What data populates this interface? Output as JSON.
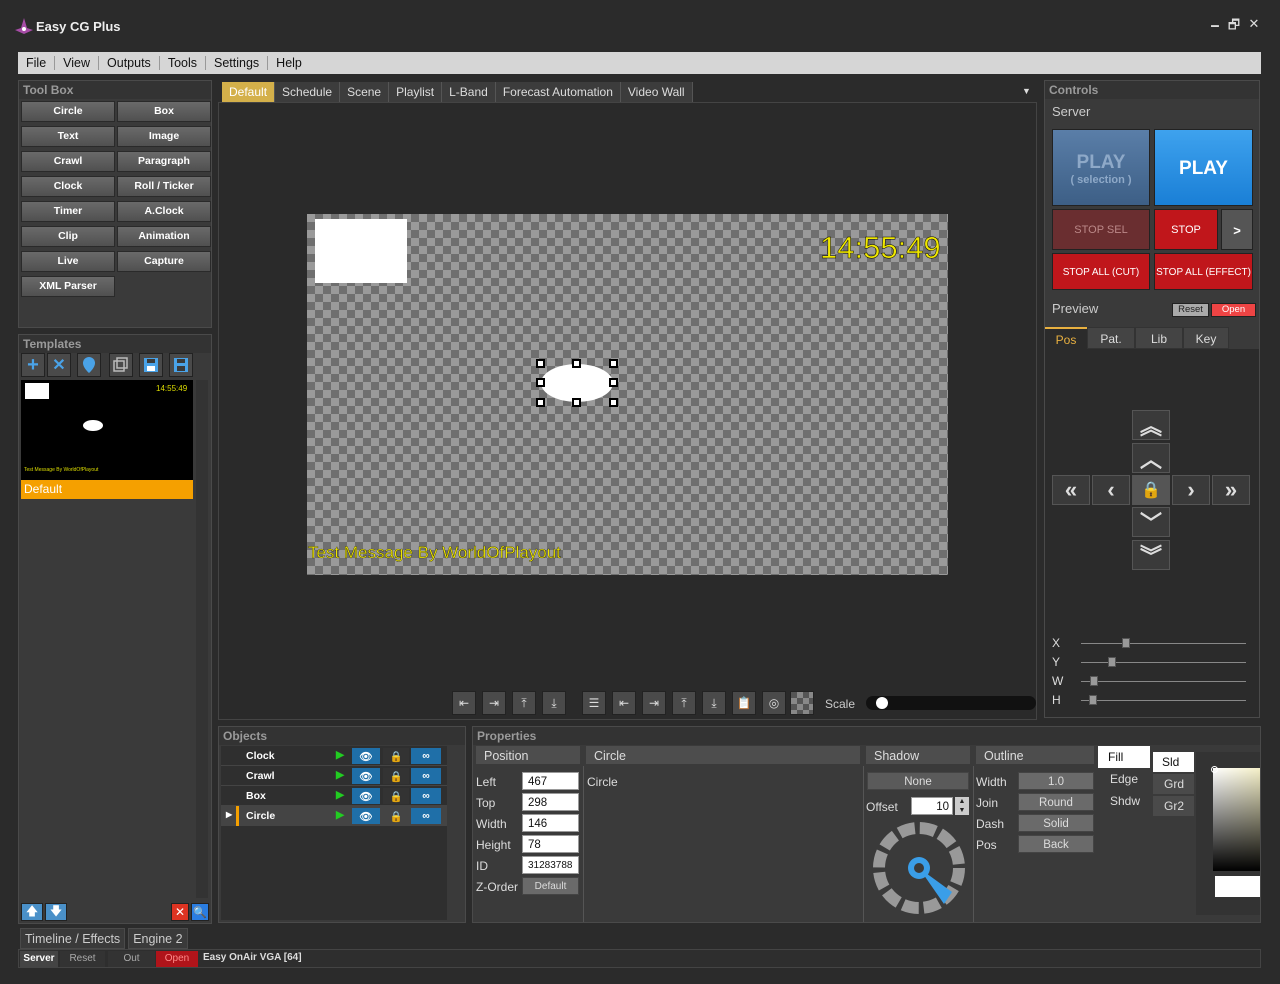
{
  "app": {
    "title": "Easy CG Plus",
    "win_min": "🗕",
    "win_max": "🗗",
    "win_close": "✕"
  },
  "menu": [
    "File",
    "View",
    "Outputs",
    "Tools",
    "Settings",
    "Help"
  ],
  "toolbox": {
    "title": "Tool Box",
    "buttons": [
      "Circle",
      "Box",
      "Text",
      "Image",
      "Crawl",
      "Paragraph",
      "Clock",
      "Roll / Ticker",
      "Timer",
      "A.Clock",
      "Clip",
      "Animation",
      "Live",
      "Capture",
      "XML Parser"
    ]
  },
  "templates": {
    "title": "Templates",
    "thumb_time": "14:55:49",
    "thumb_msg": "Test Message By WorldOfPlayout",
    "selected": "Default"
  },
  "tabs": [
    "Default",
    "Schedule",
    "Scene",
    "Playlist",
    "L-Band",
    "Forecast Automation",
    "Video Wall"
  ],
  "canvas": {
    "clock": "14:55:49",
    "message": "Test Message By WorldOfPlayout"
  },
  "toolbar": {
    "scale_label": "Scale"
  },
  "controls": {
    "title": "Controls",
    "server_label": "Server",
    "play_sel": "PLAY",
    "play_sel_sub": "( selection )",
    "play": "PLAY",
    "stop_sel": "STOP SEL",
    "stop": "STOP",
    "more": ">",
    "stop_all_cut": "STOP ALL (CUT)",
    "stop_all_effect": "STOP ALL (EFFECT)",
    "preview_label": "Preview",
    "reset": "Reset",
    "open": "Open",
    "subtabs": [
      "Pos",
      "Pat.",
      "Lib",
      "Key"
    ],
    "sliders": [
      "X",
      "Y",
      "W",
      "H"
    ],
    "slider_values": [
      0.27,
      0.19,
      0.08,
      0.07
    ]
  },
  "objects": {
    "title": "Objects",
    "rows": [
      "Clock",
      "Crawl",
      "Box",
      "Circle"
    ]
  },
  "properties": {
    "title": "Properties",
    "position_h": "Position",
    "fields": [
      {
        "label": "Left",
        "value": "467"
      },
      {
        "label": "Top",
        "value": "298"
      },
      {
        "label": "Width",
        "value": "146"
      },
      {
        "label": "Height",
        "value": "78"
      },
      {
        "label": "ID",
        "value": "31283788"
      }
    ],
    "zorder_label": "Z-Order",
    "zorder_value": "Default",
    "name_h": "Circle",
    "name_value": "Circle",
    "shadow_h": "Shadow",
    "shadow_none": "None",
    "offset_label": "Offset",
    "offset_value": "10",
    "outline_h": "Outline",
    "outline": [
      {
        "label": "Width",
        "value": "1.0"
      },
      {
        "label": "Join",
        "value": "Round"
      },
      {
        "label": "Dash",
        "value": "Solid"
      },
      {
        "label": "Pos",
        "value": "Back"
      }
    ],
    "fill_tabs": [
      "Fill",
      "Edge",
      "Shdw"
    ],
    "fill_sub": [
      "Sld",
      "Grd",
      "Gr2"
    ]
  },
  "bottom_tabs": [
    "Timeline / Effects",
    "Engine 2"
  ],
  "status": {
    "server": "Server",
    "reset": "Reset",
    "out": "Out",
    "open": "Open",
    "engine": "Easy OnAir VGA [64]"
  },
  "colors": {
    "accent": "#d4b04a",
    "play": "#1e88e5",
    "stop": "#c0161b",
    "selected": "#f5a000"
  }
}
